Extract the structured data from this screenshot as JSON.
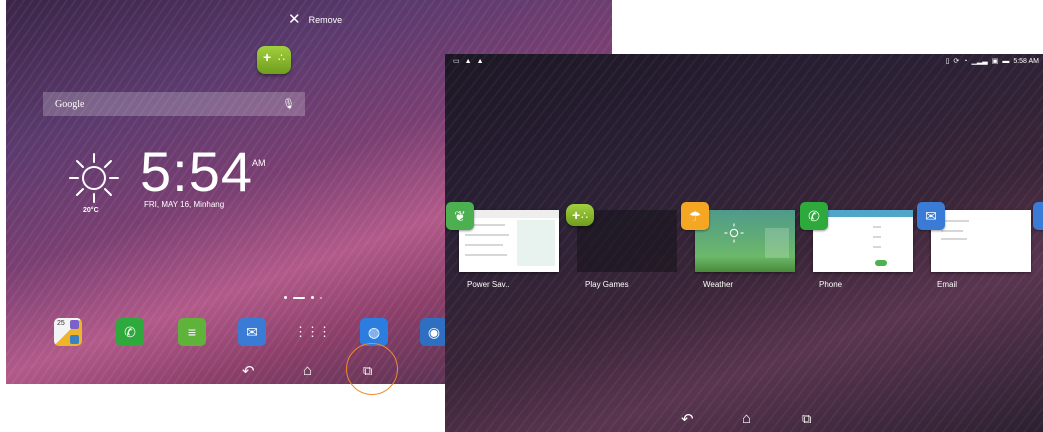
{
  "home": {
    "remove_label": "Remove",
    "search_placeholder": "Google",
    "clock": {
      "time": "5:54",
      "ampm": "AM",
      "date": "FRI, MAY 16, Minhang",
      "temp": "20°C"
    },
    "dock": [
      {
        "name": "calendar",
        "label": "25"
      },
      {
        "name": "phone",
        "label": ""
      },
      {
        "name": "messaging",
        "label": ""
      },
      {
        "name": "email",
        "label": ""
      },
      {
        "name": "all-apps",
        "label": ""
      },
      {
        "name": "browser",
        "label": ""
      },
      {
        "name": "camera",
        "label": ""
      }
    ]
  },
  "recent": {
    "status_time": "5:58 AM",
    "apps": [
      {
        "name": "power-saver",
        "label": "Power Sav.."
      },
      {
        "name": "play-games",
        "label": "Play Games"
      },
      {
        "name": "weather",
        "label": "Weather"
      },
      {
        "name": "phone",
        "label": "Phone"
      },
      {
        "name": "email",
        "label": "Email"
      }
    ]
  },
  "colors": {
    "highlight_ring": "#f08a30",
    "games_green": "#8cc63f",
    "phone_green": "#2eaa3c",
    "email_blue": "#3a7bd5",
    "weather_orange": "#f5a623",
    "power_green": "#4caf50"
  }
}
